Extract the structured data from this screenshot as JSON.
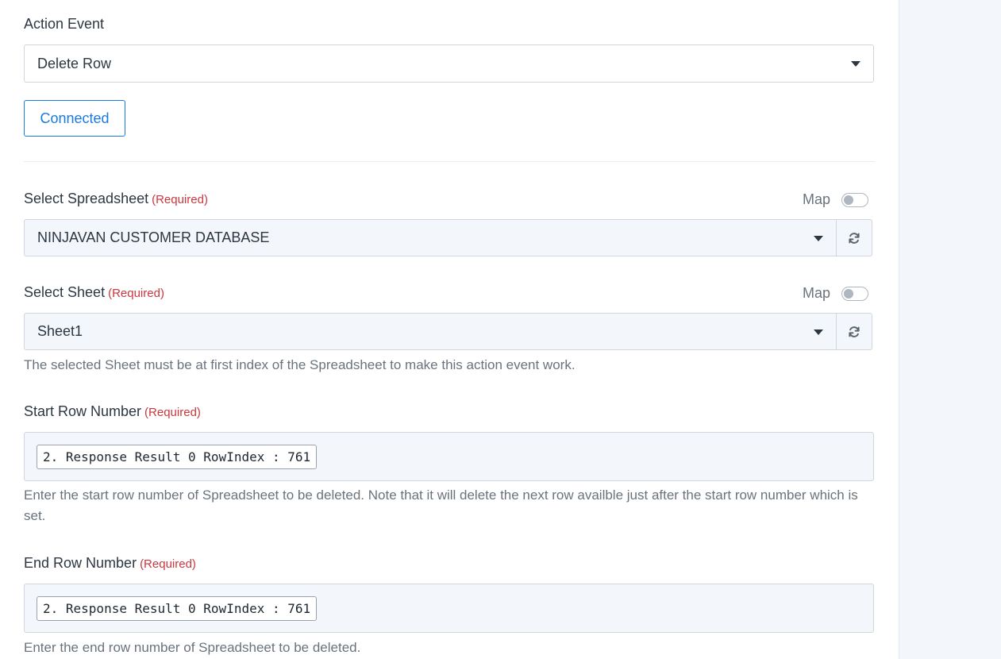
{
  "action_event": {
    "label": "Action Event",
    "value": "Delete Row"
  },
  "connected_button": "Connected",
  "spreadsheet": {
    "label": "Select Spreadsheet",
    "required": "(Required)",
    "map_label": "Map",
    "value": "NINJAVAN CUSTOMER DATABASE"
  },
  "sheet": {
    "label": "Select Sheet",
    "required": "(Required)",
    "map_label": "Map",
    "value": "Sheet1",
    "help": "The selected Sheet must be at first index of the Spreadsheet to make this action event work."
  },
  "start_row": {
    "label": "Start Row Number",
    "required": "(Required)",
    "chip": "2. Response Result 0 RowIndex : 761",
    "help": "Enter the start row number of Spreadsheet to be deleted. Note that it will delete the next row availble just after the start row number which is set."
  },
  "end_row": {
    "label": "End Row Number",
    "required": "(Required)",
    "chip": "2. Response Result 0 RowIndex : 761",
    "help": "Enter the end row number of Spreadsheet to be deleted."
  },
  "icons": {
    "dropdown": "caret-down-icon",
    "refresh": "refresh-icon"
  },
  "colors": {
    "accent": "#1a7ae0",
    "required": "#c9373f",
    "field_bg": "#f3f6fa"
  }
}
